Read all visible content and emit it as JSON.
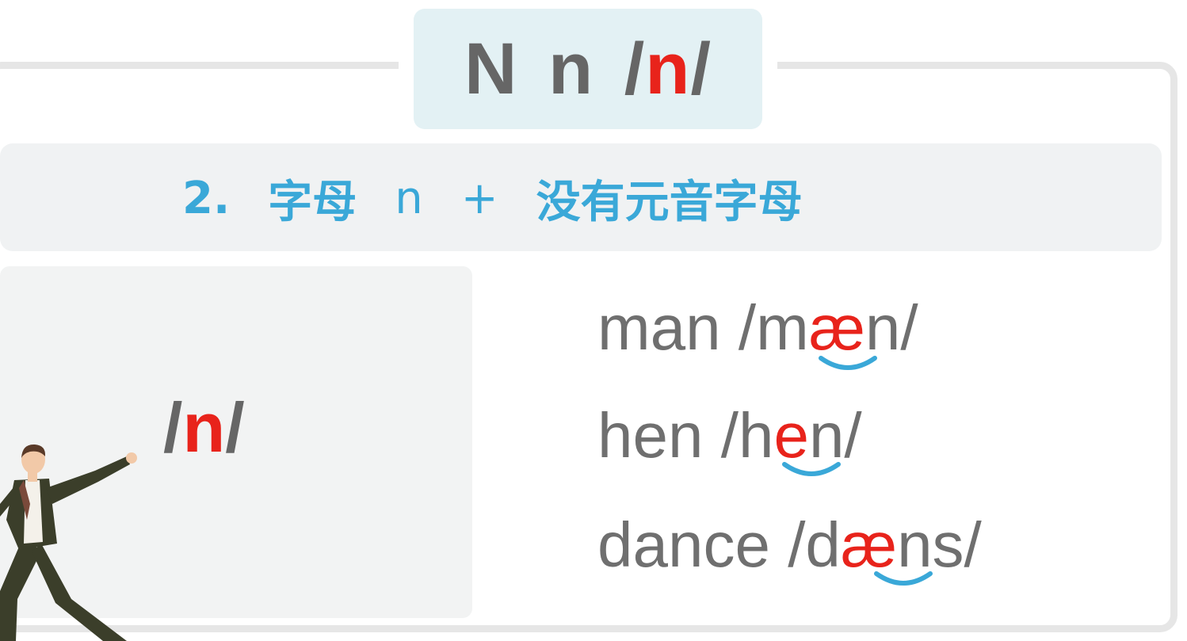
{
  "title": {
    "letters": "N n /",
    "phoneme": "n",
    "close": "/"
  },
  "rule": {
    "number": "2.",
    "text_a": "字母",
    "letter": "n",
    "plus": "+",
    "text_b": "没有元音字母"
  },
  "phoneme_label": {
    "open": "/",
    "sound": "n",
    "close": "/"
  },
  "words": [
    {
      "word": "man",
      "pre": "/m",
      "vowel": "æ",
      "post": "n/"
    },
    {
      "word": "hen",
      "pre": "/h",
      "vowel": "e",
      "post": "n/"
    },
    {
      "word": "dance",
      "pre": "/d",
      "vowel": "æ",
      "post": "ns/"
    }
  ],
  "colors": {
    "accent_red": "#e8231b",
    "rule_blue": "#3aa8d8",
    "text_gray": "#666666",
    "arc_blue": "#3aa8d8"
  },
  "figure": {
    "icon": "dancer-illustration"
  }
}
